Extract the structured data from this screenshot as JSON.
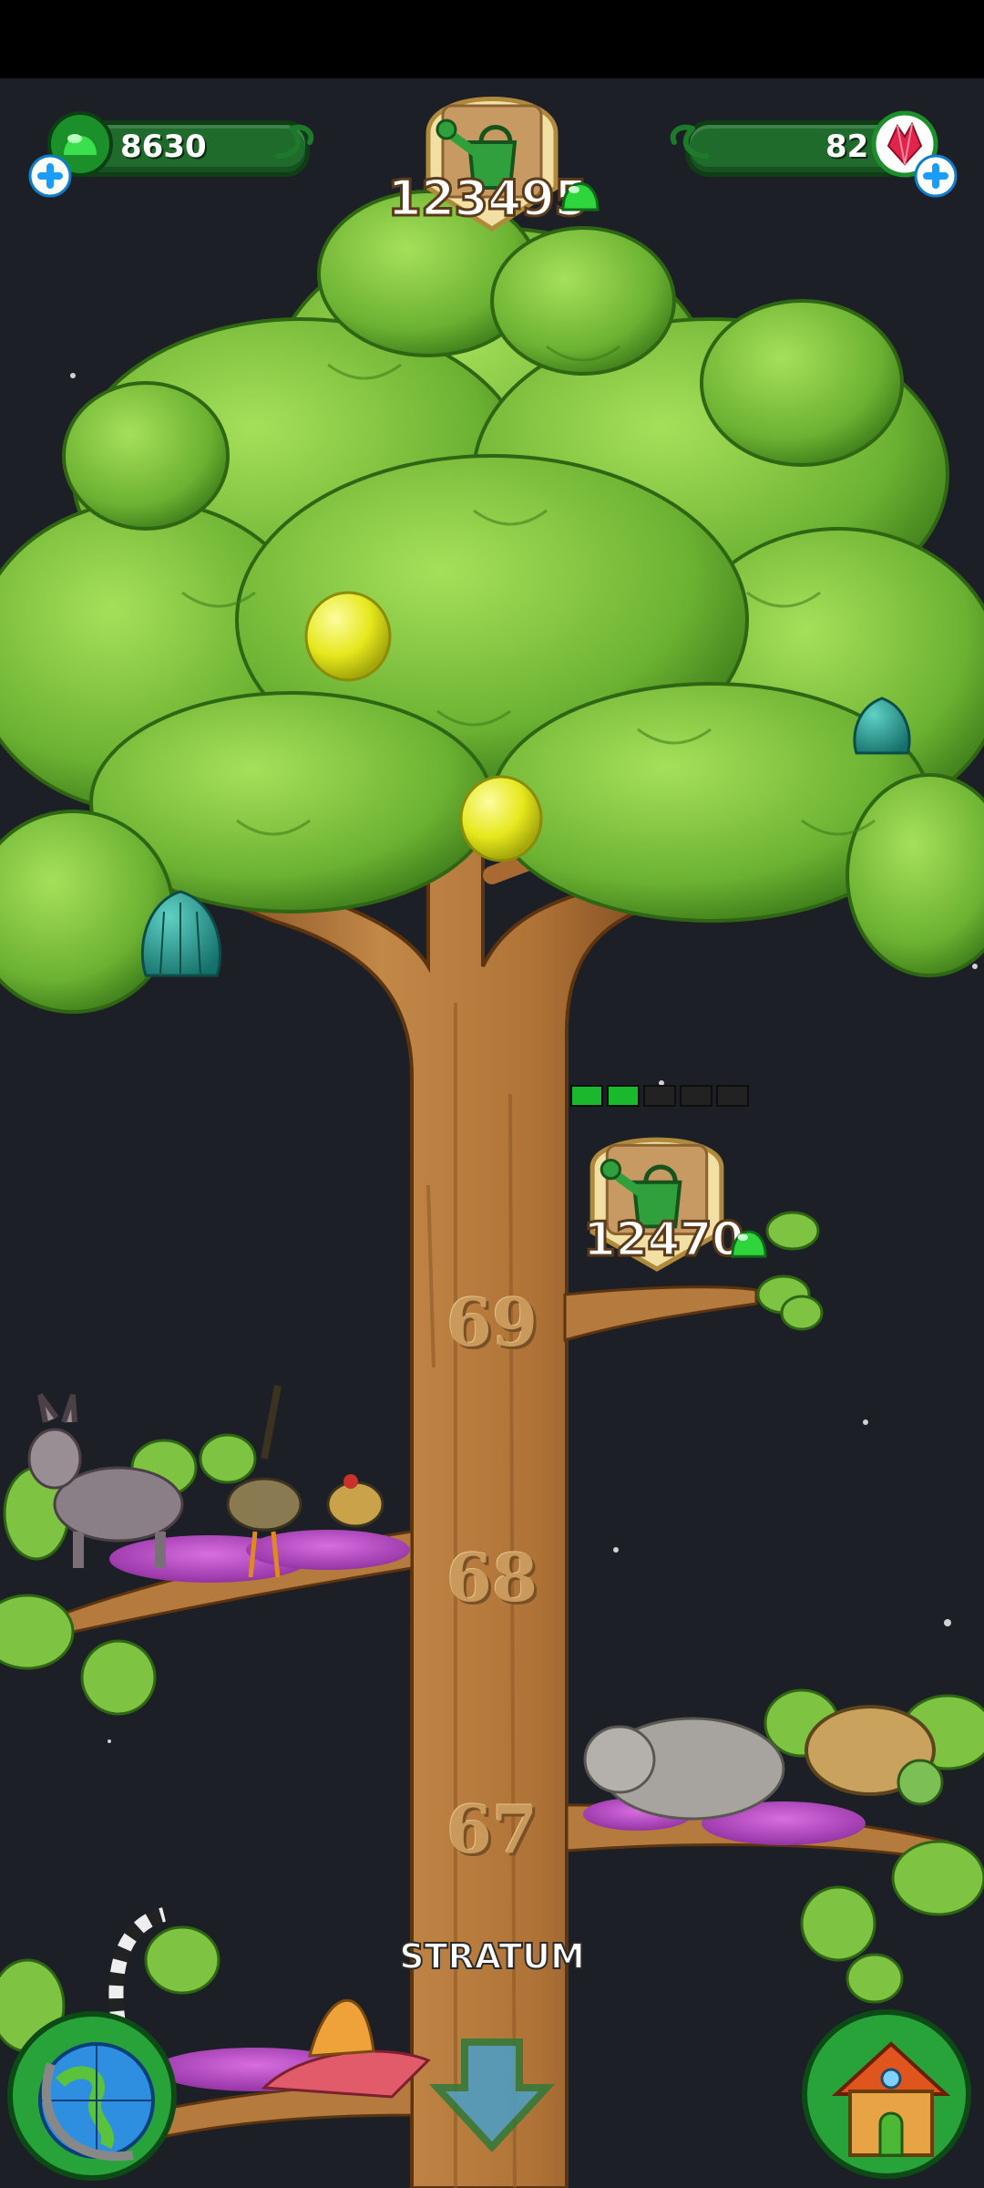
{
  "hud": {
    "gems": {
      "value": "8630",
      "icon": "green-gem-icon",
      "add_icon": "plus-icon"
    },
    "water": {
      "value": "123495",
      "icon": "watering-can-icon",
      "currency_icon": "green-gem-icon"
    },
    "crystals": {
      "value": "82",
      "icon": "red-crystal-icon",
      "add_icon": "plus-icon"
    }
  },
  "tree": {
    "levels": [
      {
        "number": "69"
      },
      {
        "number": "68"
      },
      {
        "number": "67"
      }
    ],
    "upgrade": {
      "cost": "12470",
      "icon": "watering-can-icon",
      "currency_icon": "green-gem-icon",
      "progress": {
        "filled": 2,
        "total": 5
      }
    },
    "fruits": [
      "yellow-fruit-icon",
      "yellow-fruit-icon",
      "teal-seed-icon",
      "teal-seed-icon"
    ]
  },
  "animals": [
    "donkey",
    "roadrunner",
    "woodpecker",
    "manatee",
    "tortoise",
    "lemur",
    "spinosaurus",
    "anteater"
  ],
  "bottom": {
    "stratum_label": "STRATUM",
    "globe_icon": "globe-icon",
    "down_icon": "down-arrow-icon",
    "house_icon": "house-icon"
  },
  "colors": {
    "background": "#1c1f26",
    "leaf": "#7ec341",
    "leaf_dark": "#3f7d1e",
    "trunk": "#b97a3f",
    "gem_green": "#2ed63c",
    "accent_blue": "#29a7ff"
  }
}
